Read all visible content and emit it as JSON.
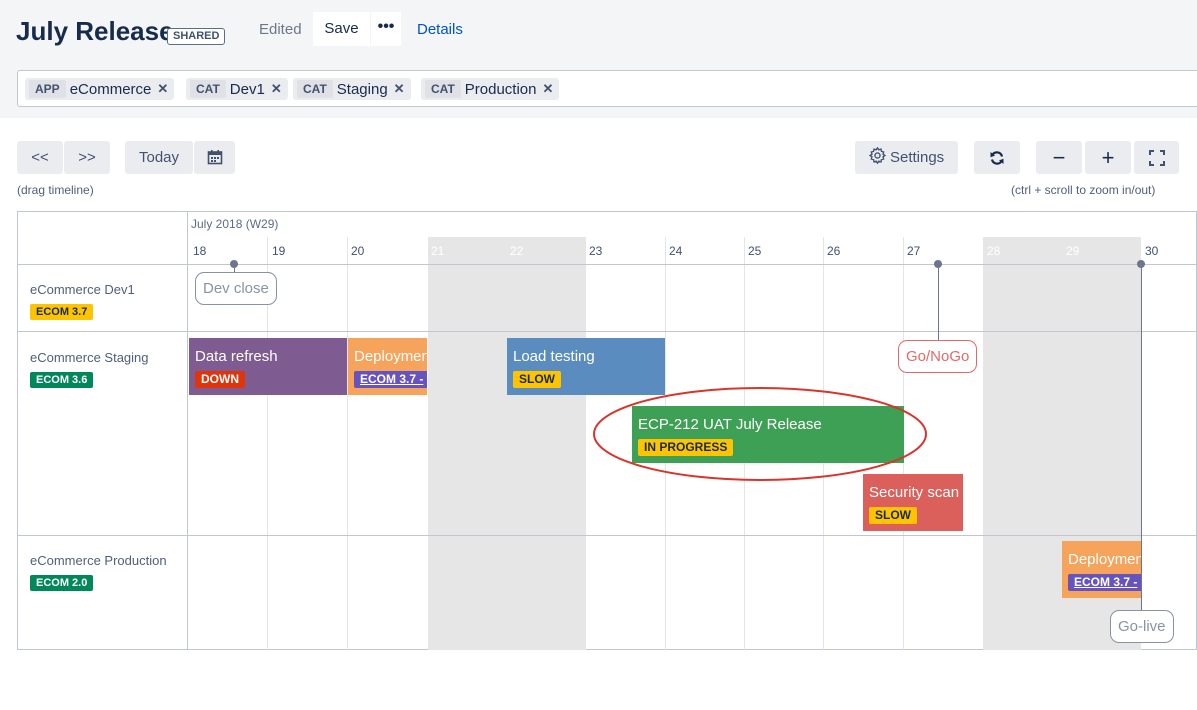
{
  "header": {
    "title": "July Release",
    "shared_badge": "SHARED",
    "edited": "Edited",
    "save_label": "Save",
    "more_label": "•••",
    "details_label": "Details"
  },
  "filters": [
    {
      "type": "APP",
      "value": "eCommerce"
    },
    {
      "type": "CAT",
      "value": "Dev1"
    },
    {
      "type": "CAT",
      "value": "Staging"
    },
    {
      "type": "CAT",
      "value": "Production"
    }
  ],
  "filter_remove_glyph": "✕",
  "toolbar": {
    "prev_label": "<<",
    "next_label": ">>",
    "today_label": "Today",
    "calendar_icon": "calendar-icon",
    "drag_hint": "(drag timeline)",
    "settings_label": "Settings",
    "settings_icon": "gear-icon",
    "refresh_icon": "refresh-icon",
    "zoom_out_label": "−",
    "zoom_in_label": "+",
    "fullscreen_icon": "fullscreen-icon",
    "zoom_hint": "(ctrl + scroll to zoom in/out)"
  },
  "timeline": {
    "month_label": "July 2018 (W29)",
    "days": [
      "18",
      "19",
      "20",
      "21",
      "22",
      "23",
      "24",
      "25",
      "26",
      "27",
      "28",
      "29",
      "30"
    ],
    "weekend_days": [
      "21",
      "22",
      "28",
      "29"
    ]
  },
  "lanes": [
    {
      "name": "eCommerce Dev1",
      "tag": "ECOM 3.7",
      "tag_color": "#ffc400",
      "tag_text_color": "#172b4d"
    },
    {
      "name": "eCommerce Staging",
      "tag": "ECOM 3.6",
      "tag_color": "#00875a",
      "tag_text_color": "#ffffff"
    },
    {
      "name": "eCommerce Production",
      "tag": "ECOM 2.0",
      "tag_color": "#00875a",
      "tag_text_color": "#ffffff"
    }
  ],
  "milestones": [
    {
      "label": "Dev close",
      "color": "#8993a4"
    },
    {
      "label": "Go/NoGo",
      "color": "#de6b6b"
    },
    {
      "label": "Go-live",
      "color": "#8993a4"
    }
  ],
  "events": [
    {
      "title": "Data refresh",
      "badge": "DOWN",
      "color": "#7e5c91",
      "badge_bg": "#de350b",
      "badge_fg": "#ffffff"
    },
    {
      "title": "Deployment",
      "badge": "ECOM 3.7 - ",
      "color": "#f6a35b",
      "badge_bg": "#6554c0",
      "badge_fg": "#ffffff"
    },
    {
      "title": "Load testing",
      "badge": "SLOW",
      "color": "#5b8cc0",
      "badge_bg": "#ffc400",
      "badge_fg": "#172b4d"
    },
    {
      "title": "ECP-212 UAT July Release",
      "badge": "IN PROGRESS",
      "color": "#3ea055",
      "badge_bg": "#ffc400",
      "badge_fg": "#172b4d"
    },
    {
      "title": "Security scan",
      "badge": "SLOW",
      "color": "#db5f5a",
      "badge_bg": "#ffc400",
      "badge_fg": "#172b4d"
    },
    {
      "title": "Deployment",
      "badge": "ECOM 3.7 - ",
      "color": "#f6a35b",
      "badge_bg": "#6554c0",
      "badge_fg": "#ffffff"
    }
  ],
  "colors": {
    "accent_link": "#0052cc",
    "annotation_ellipse": "#d9352a"
  }
}
